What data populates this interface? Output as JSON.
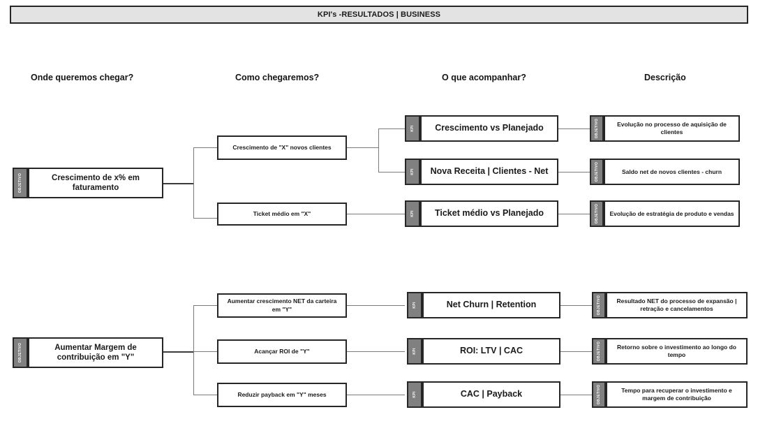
{
  "header": {
    "title": "KPI's -RESULTADOS | BUSINESS"
  },
  "columns": [
    {
      "label": "Onde queremos chegar?"
    },
    {
      "label": "Como chegaremos?"
    },
    {
      "label": "O que acompanhar?"
    },
    {
      "label": "Descrição"
    }
  ],
  "tabs": {
    "objective": "OBJETIVO",
    "kpi": "KPI",
    "desc": "OBJETIVO"
  },
  "colors": {
    "tab_gray": "#808080",
    "border_dark": "#262626",
    "title_bar_bg": "#e3e3e3",
    "connector": "#7a7a7a",
    "connector_thick": "#3c3c3c",
    "page_bg": "#ffffff"
  },
  "sections": [
    {
      "objective": "Crescimento de x% em faturamento",
      "strategies": [
        "Crescimento de \"X\" novos clientes",
        "Ticket médio em \"X\""
      ],
      "kpis": [
        "Crescimento vs Planejado",
        "Nova Receita | Clientes - Net",
        "Ticket médio vs Planejado"
      ],
      "descriptions": [
        "Evolução no processo de aquisição de clientes",
        "Saldo net de novos clientes - churn",
        "Evolução de estratégia de produto e vendas"
      ]
    },
    {
      "objective": "Aumentar Margem de contribuição em \"Y\"",
      "strategies": [
        "Aumentar crescimento NET da carteira em \"Y\"",
        "Acançar ROI de \"Y\"",
        "Reduzir payback em \"Y\" meses"
      ],
      "kpis": [
        "Net Churn | Retention",
        "ROI: LTV | CAC",
        "CAC | Payback"
      ],
      "descriptions": [
        "Resultado NET do processo de expansão | retração e cancelamentos",
        "Retorno sobre o investimento ao longo do tempo",
        "Tempo para recuperar o investimento e margem de contribuição"
      ]
    }
  ]
}
